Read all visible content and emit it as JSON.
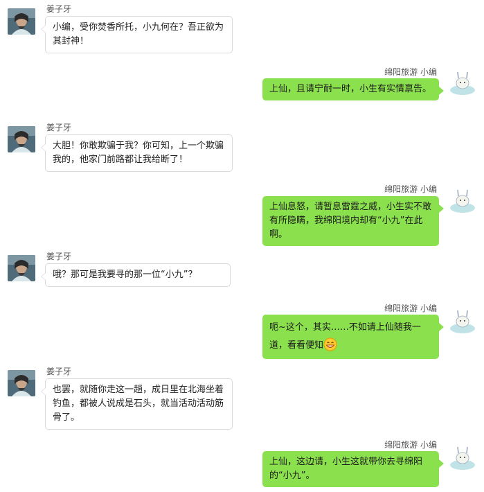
{
  "colors": {
    "bubble_right": "#8be04e",
    "bubble_left": "#ffffff",
    "bubble_left_border": "#d9d9d9"
  },
  "messages": [
    {
      "side": "left",
      "sender": "姜子牙",
      "text": "小编，受你焚香所托，小九何在？吾正欲为其封神！",
      "avatar": "jiang-ziya-avatar"
    },
    {
      "side": "right",
      "sender": "绵阳旅游 小编",
      "text": "上仙，且请宁耐一时，小生有实情禀告。",
      "avatar": "xiaobian-avatar"
    },
    {
      "side": "left",
      "sender": "姜子牙",
      "text": "大胆！你敢欺骗于我？你可知，上一个欺骗我的，他家门前路都让我给断了！",
      "avatar": "jiang-ziya-avatar"
    },
    {
      "side": "right",
      "sender": "绵阳旅游 小编",
      "text": "上仙息怒，请暂息雷霆之威，小生实不敢有所隐瞒，我绵阳境内却有“小九”在此啊。",
      "avatar": "xiaobian-avatar"
    },
    {
      "side": "left",
      "sender": "姜子牙",
      "text": "哦？那可是我要寻的那一位“小九”？",
      "avatar": "jiang-ziya-avatar"
    },
    {
      "side": "right",
      "sender": "绵阳旅游 小编",
      "text": "呃~这个，其实……不如请上仙随我一道，看看便知",
      "emoji": "grin-emoji",
      "avatar": "xiaobian-avatar"
    },
    {
      "side": "left",
      "sender": "姜子牙",
      "text": "也罢，就随你走这一趟，成日里在北海坐着钓鱼，都被人说成是石头，就当活动活动筋骨了。",
      "avatar": "jiang-ziya-avatar"
    },
    {
      "side": "right",
      "sender": "绵阳旅游 小编",
      "text": "上仙，这边请，小生这就带你去寻绵阳的“小九”。",
      "avatar": "xiaobian-avatar"
    }
  ]
}
